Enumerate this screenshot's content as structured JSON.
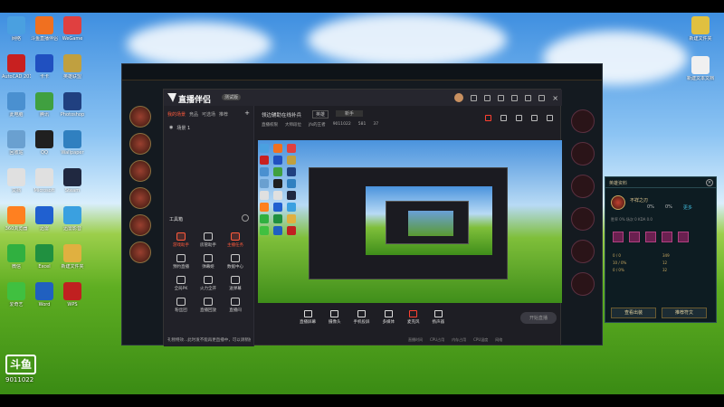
{
  "desktop": {
    "icons_left": [
      {
        "label": "网络",
        "color": "#4aa0e0"
      },
      {
        "label": "斗鱼直播伴侣",
        "color": "#f07020"
      },
      {
        "label": "WeGame",
        "color": "#e04040"
      },
      {
        "label": "AutoCAD 2014",
        "color": "#c82020"
      },
      {
        "label": "卡卡",
        "color": "#2050c0"
      },
      {
        "label": "英雄联盟",
        "color": "#c0a040"
      },
      {
        "label": "此电脑",
        "color": "#4a90d0"
      },
      {
        "label": "腾讯",
        "color": "#40a040"
      },
      {
        "label": "Photoshop",
        "color": "#204080"
      },
      {
        "label": "回收站",
        "color": "#6aa0d0"
      },
      {
        "label": "QQ",
        "color": "#202020"
      },
      {
        "label": "Wallpaper",
        "color": "#3080c0"
      },
      {
        "label": "文档",
        "color": "#e0e0e0"
      },
      {
        "label": "Microsoft",
        "color": "#e0e0e0"
      },
      {
        "label": "Steam",
        "color": "#202840"
      },
      {
        "label": "360浏览器",
        "color": "#ff8020"
      },
      {
        "label": "迅雷",
        "color": "#2060d0"
      },
      {
        "label": "迅雷影音",
        "color": "#3aa0e0"
      },
      {
        "label": "微信",
        "color": "#30b040"
      },
      {
        "label": "Excel",
        "color": "#209040"
      },
      {
        "label": "新建文件夹",
        "color": "#e0b040"
      },
      {
        "label": "爱奇艺",
        "color": "#40c040"
      },
      {
        "label": "Word",
        "color": "#2060c0"
      },
      {
        "label": "WPS",
        "color": "#c02020"
      }
    ],
    "icons_right": [
      {
        "label": "新建文件夹",
        "color": "#e0c040"
      },
      {
        "label": "新建文本文档",
        "color": "#f0f0f0"
      }
    ]
  },
  "app": {
    "title": "直播伴侣",
    "badge": "测试版",
    "left_tabs": [
      "我的场景",
      "竞品",
      "可选场",
      "推荐"
    ],
    "scene_name": "场景 1",
    "tools_header": "工具箱",
    "tools": [
      {
        "label": "游戏助手",
        "red": true
      },
      {
        "label": "房管助手",
        "red": false
      },
      {
        "label": "主播任务",
        "red": true
      },
      {
        "label": "预约直播",
        "red": false
      },
      {
        "label": "弹幕姬",
        "red": false
      },
      {
        "label": "数据中心",
        "red": false
      },
      {
        "label": "全局PK",
        "red": false
      },
      {
        "label": "火力全开",
        "red": false
      },
      {
        "label": "送弹幕",
        "red": false
      },
      {
        "label": "粉丝团",
        "red": false
      },
      {
        "label": "直播回放",
        "red": false
      },
      {
        "label": "直播间",
        "red": false
      }
    ],
    "notice": "礼物特效...此时发不能再更直播中，可以请稍候",
    "room_title": "领边辅助在线补兵",
    "category": "英雄",
    "subcategory": "新手",
    "meta": [
      "直播权限",
      "大师段位",
      "jfs的王者",
      "9011022",
      "581",
      "37"
    ],
    "bottom_buttons": [
      "直播屏幕",
      "摄像头",
      "手机投屏",
      "多媒体",
      "麦克风",
      "扬声器"
    ],
    "start_label": "开始直播",
    "status_items": [
      "直播时间",
      "CPU占用",
      "内存占用",
      "CPU温度",
      "网络"
    ]
  },
  "profile": {
    "header": "英雄资料",
    "champion": "不祥之刃",
    "stat1": "0%",
    "stat2": "0%",
    "link": "更多",
    "row": "胜率 0%  场次 0  KDA 0.0",
    "meta": [
      "0 / 0",
      "349",
      "10 / 0%",
      "12",
      "0 / 0%",
      "32"
    ],
    "btn_left": "查看出装",
    "btn_right": "推荐符文"
  },
  "watermark": {
    "logo": "斗鱼",
    "room_id": "9011022"
  }
}
